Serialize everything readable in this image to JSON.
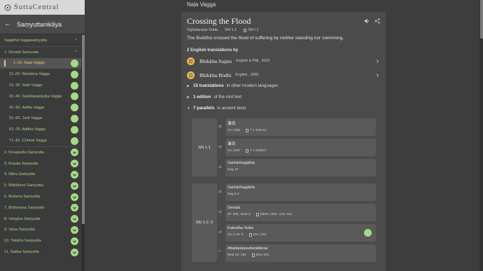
{
  "brand": {
    "name": "SuttaCentral"
  },
  "sidebar": {
    "header": "Saṃyuttanikāya",
    "items": [
      {
        "label": "Sagāthā Vaggasaṃyutta",
        "level": 0,
        "icon": "chevron-up"
      },
      {
        "label": "1. Devatā Saṃyutta",
        "level": 1,
        "icon": "chevron-up"
      },
      {
        "label": "1–10. Naḷa Vagga",
        "level": 2,
        "icon": "dot",
        "selected": true
      },
      {
        "label": "11–20. Nandana Vagga",
        "level": 2,
        "icon": "dot"
      },
      {
        "label": "21–30. Satti Vagga",
        "level": 2,
        "icon": "dot"
      },
      {
        "label": "31–40. Satullapakāyika Vagga",
        "level": 2,
        "icon": "dot"
      },
      {
        "label": "41–50. Āditta Vagga",
        "level": 2,
        "icon": "dot"
      },
      {
        "label": "51–60. Jarā Vagga",
        "level": 2,
        "icon": "dot"
      },
      {
        "label": "61–70. Addha Vagga",
        "level": 2,
        "icon": "dot"
      },
      {
        "label": "71–81. Chetvā Vagga",
        "level": 2,
        "icon": "dot"
      },
      {
        "label": "2. Devaputta Saṃyutta",
        "level": 1,
        "icon": "check"
      },
      {
        "label": "3. Kosala Saṃyutta",
        "level": 1,
        "icon": "check"
      },
      {
        "label": "4. Māra Saṃyutta",
        "level": 1,
        "icon": "check"
      },
      {
        "label": "5. Bhikkhunī Saṃyutta",
        "level": 1,
        "icon": "check"
      },
      {
        "label": "6. Brahma Saṃyutta",
        "level": 1,
        "icon": "check"
      },
      {
        "label": "7. Brāhmaṇa Saṃyutta",
        "level": 1,
        "icon": "check"
      },
      {
        "label": "8. Vaṅgīsa Saṃyutta",
        "level": 1,
        "icon": "check"
      },
      {
        "label": "9. Vana Saṃyutta",
        "level": 1,
        "icon": "check"
      },
      {
        "label": "10. Yakkha Saṃyutta",
        "level": 1,
        "icon": "check"
      },
      {
        "label": "11. Sakka Saṃyutta",
        "level": 1,
        "icon": "check"
      }
    ]
  },
  "main": {
    "vagga_title": "Naḷa Vagga",
    "sutta": {
      "title": "Crossing the Flood",
      "pali_title": "Oghataraṇa Sutta",
      "id": "SN 1.1",
      "pts_ref": "SN i 1",
      "blurb": "The Buddha crossed the flood of suffering by neither standing nor swimming."
    },
    "translations_heading": "2 English translations by",
    "translations": [
      {
        "name": "Bhikkhu Sujato",
        "info": "English & Pāli , 2018"
      },
      {
        "name": "Bhikkhu Bodhi",
        "info": "English , 2000"
      }
    ],
    "other_langs": {
      "count": "15 translations",
      "rest": "in other modern languages"
    },
    "root_text": {
      "count": "1 edition",
      "rest": "of the root text"
    },
    "parallels_heading": {
      "count": "7 parallels",
      "rest": "in ancient texts"
    },
    "parallel_groups": [
      {
        "source": "SN 1.1",
        "items": [
          {
            "icon": "⇄",
            "title": "瀑流",
            "id": "SA 1280",
            "ref": "T ii 438c12"
          },
          {
            "icon": "⇄",
            "title": "瀑流",
            "id": "SA 1267",
            "ref": "T ii 348b07"
          },
          {
            "icon": "⇄",
            "title": "Sarīrārthagāthā",
            "id": "Sag 13",
            "ref": ""
          }
        ]
      },
      {
        "source": "SN 1.1: 2",
        "items": [
          {
            "icon": "⇄",
            "title": "Sarīrārthagāthā",
            "id": "Sag 5.3",
            "ref": ""
          },
          {
            "icon": "⇄",
            "title": "Devatā",
            "id": "SF 105: 1545.2",
            "ref": "Mette 1981: 133–151"
          },
          {
            "icon": "⇄",
            "title": "Kakudha Sutta",
            "id": "SN 2.18: 6",
            "ref": "SN i 123",
            "dot": true
          },
          {
            "icon": "❞",
            "title": "Attadaṇḍasuttaniddesa",
            "id": "Mnd 15: 165",
            "ref": "Mnd 401"
          }
        ]
      }
    ]
  },
  "colors": {
    "accent_green": "#a5d984",
    "selected": "#f0c36d",
    "translator_icon": "#e7b94f"
  }
}
